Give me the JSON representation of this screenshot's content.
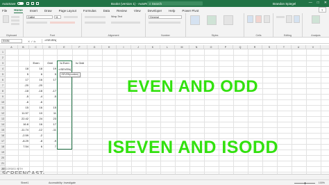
{
  "titlebar": {
    "autosave_label": "AutoSave",
    "doc_title": "Book4 (version 1) - AutoRecovered",
    "search_placeholder": "Search",
    "user_name": "Brandon Spiegel"
  },
  "ribbon": {
    "tabs": [
      "File",
      "Home",
      "Insert",
      "Draw",
      "Page Layout",
      "Formulas",
      "Data",
      "Review",
      "View",
      "Developer",
      "Help",
      "Power Pivot"
    ],
    "active_tab": "Home",
    "groups": [
      "Clipboard",
      "Font",
      "Alignment",
      "Number",
      "Styles",
      "Cells",
      "Editing",
      "Analysis"
    ],
    "font_name": "Calibri",
    "font_size": "11",
    "wrap_text": "Wrap Text",
    "number_format": "General"
  },
  "formula_bar": {
    "name_box": "EMIN",
    "formula": "=ISEVEN("
  },
  "grid": {
    "columns": [
      "A",
      "B",
      "C",
      "D",
      "E",
      "F",
      "G",
      "H",
      "I",
      "J",
      "K",
      "L",
      "M",
      "N",
      "O",
      "P",
      "Q",
      "R",
      "S",
      "T",
      "U",
      "V"
    ],
    "rows": [
      "1",
      "2",
      "3",
      "4",
      "5",
      "6",
      "7",
      "8",
      "9",
      "10",
      "11",
      "12",
      "13",
      "14",
      "15",
      "16",
      "17",
      "18",
      "19",
      "20",
      "21",
      "22"
    ],
    "header_row": {
      "even": "Even",
      "odd": "Odd",
      "is_even": "Is Even",
      "is_odd": "Is Odd"
    },
    "values": [
      "18",
      "5",
      "17",
      "-20",
      "-18",
      "-5",
      "-6",
      "15",
      "11.57",
      "22.42",
      "16.8",
      "-11.74",
      "-2.59",
      "-8.29",
      "7.54"
    ],
    "even": [
      "18",
      "6",
      "16",
      "-20",
      "-18",
      "-4",
      "-6",
      "16",
      "10",
      "24",
      "16",
      "-12",
      "-2",
      "-8",
      "6"
    ],
    "odd": [
      "19",
      "5",
      "17",
      "",
      "-17",
      "-5",
      "",
      "15",
      "11",
      "23",
      "17",
      "-11",
      "",
      "-9",
      "7"
    ],
    "active_cell_formula": "=ISEVEN(",
    "tooltip": "ISEVEN(number)"
  },
  "overlay": {
    "caption_top": "EVEN AND ODD",
    "caption_bottom": "ISEVEN AND ISODD"
  },
  "watermark": {
    "small": "RECORDED WITH",
    "big": "SCREENCAST-O-MATIC"
  },
  "status_bar": {
    "left": "Sheet1",
    "middle": "Accessibility: Investigate",
    "zoom": "100%"
  },
  "colors": {
    "brand": "#217346",
    "caption": "#32e10e"
  }
}
